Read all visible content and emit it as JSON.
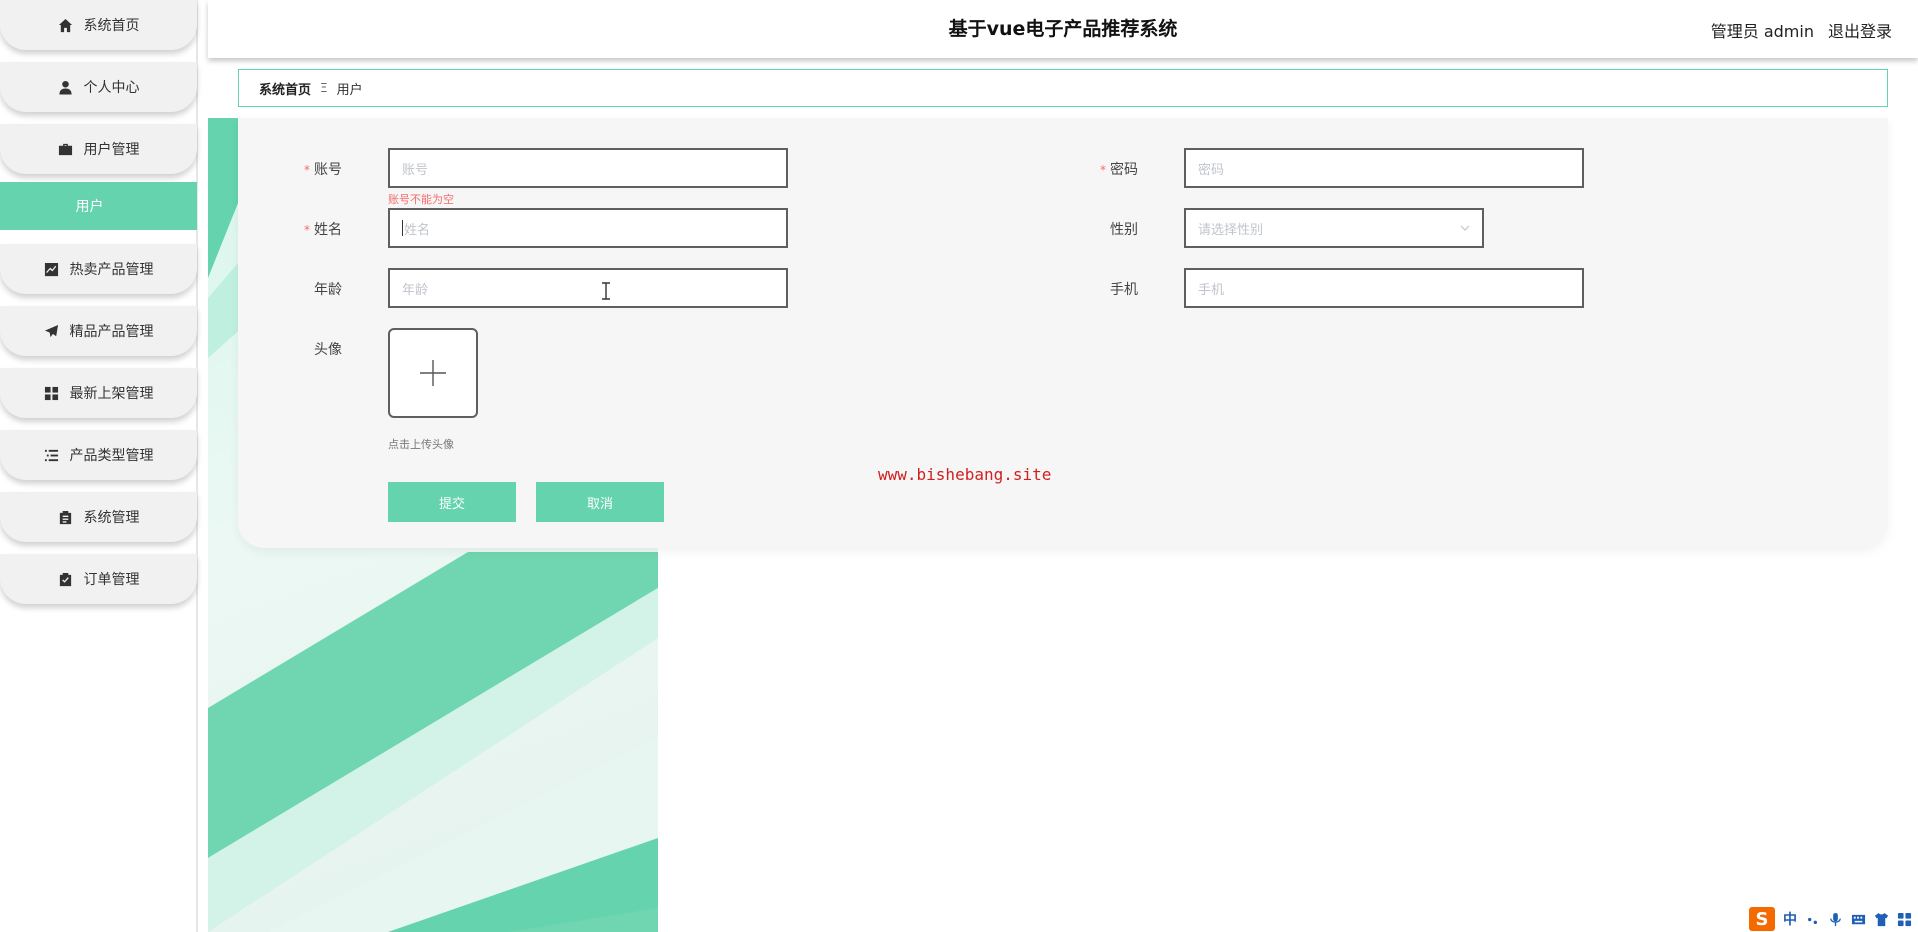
{
  "header": {
    "title": "基于vue电子产品推荐系统",
    "user_role": "管理员 admin",
    "logout": "退出登录"
  },
  "sidebar": {
    "items": [
      {
        "label": "系统首页",
        "icon": "home-icon"
      },
      {
        "label": "个人中心",
        "icon": "user-icon"
      },
      {
        "label": "用户管理",
        "icon": "briefcase-icon"
      },
      {
        "label": "热卖产品管理",
        "icon": "trend-chart-icon"
      },
      {
        "label": "精品产品管理",
        "icon": "send-icon"
      },
      {
        "label": "最新上架管理",
        "icon": "grid-icon"
      },
      {
        "label": "产品类型管理",
        "icon": "list-icon"
      },
      {
        "label": "系统管理",
        "icon": "clipboard-icon"
      },
      {
        "label": "订单管理",
        "icon": "clipboard-check-icon"
      }
    ],
    "active_submenu": "用户"
  },
  "breadcrumb": {
    "home": "系统首页",
    "separator": "Ξ",
    "current": "用户"
  },
  "form": {
    "account": {
      "label": "账号",
      "placeholder": "账号",
      "required": true,
      "error": "账号不能为空"
    },
    "password": {
      "label": "密码",
      "placeholder": "密码",
      "required": true
    },
    "name": {
      "label": "姓名",
      "placeholder": "姓名",
      "required": true
    },
    "gender": {
      "label": "性别",
      "placeholder": "请选择性别"
    },
    "age": {
      "label": "年龄",
      "placeholder": "年龄"
    },
    "phone": {
      "label": "手机",
      "placeholder": "手机"
    },
    "avatar": {
      "label": "头像",
      "hint": "点击上传头像"
    },
    "submit": "提交",
    "cancel": "取消",
    "required_mark": "*"
  },
  "watermark": "www.bishebang.site",
  "ime": {
    "logo": "S",
    "mode": "中"
  },
  "colors": {
    "accent": "#64d3ae",
    "error": "#f56c6c",
    "watermark": "#d02020"
  }
}
